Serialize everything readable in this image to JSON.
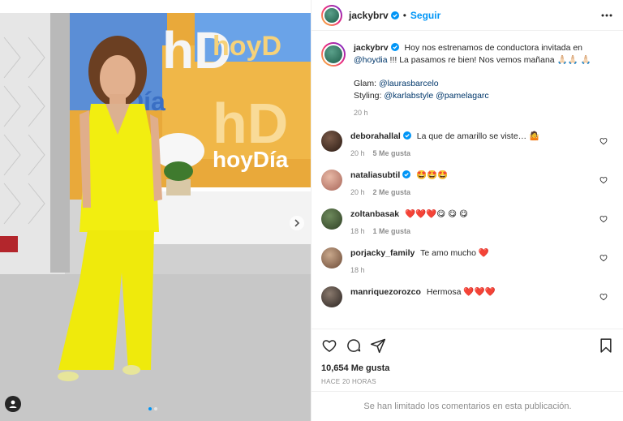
{
  "post": {
    "username": "jackybrv",
    "follow_label": "Seguir",
    "separator": "•",
    "more_icon": "more-horizontal-icon"
  },
  "media": {
    "image_text_top": "hoyD",
    "image_text_mid": "hoyDía",
    "image_text_badge": "hD"
  },
  "caption": {
    "username": "jackybrv",
    "text_part1": "Hoy nos estrenamos de conductora invitada en",
    "mention1": "@hoydia",
    "text_part2": "!!! La pasamos re bien! Nos vemos mañana 🙏🏻🙏🏻 🙏🏻",
    "glam_label": "Glam:",
    "glam_mention": "@laurasbarcelo",
    "styling_label": "Styling:",
    "styling_mention1": "@karlabstyle",
    "styling_mention2": "@pamelagarc",
    "time": "20 h"
  },
  "comments": [
    {
      "username": "deborahallal",
      "text": "La que de amarillo se viste… 🤷",
      "time": "20 h",
      "likes": "5 Me gusta",
      "verified": true
    },
    {
      "username": "nataliasubtil",
      "text": "🤩🤩🤩",
      "time": "20 h",
      "likes": "2 Me gusta",
      "verified": true
    },
    {
      "username": "zoltanbasak",
      "text": "❤️❤️❤️😋 😋 😋",
      "time": "18 h",
      "likes": "1 Me gusta",
      "verified": false
    },
    {
      "username": "porjacky_family",
      "text": "Te amo mucho ❤️",
      "time": "18 h",
      "likes": "",
      "verified": false
    },
    {
      "username": "manriquezorozco",
      "text": "Hermosa ❤️❤️❤️",
      "time": "",
      "likes": "",
      "verified": false
    }
  ],
  "actions": {
    "likes": "10,654 Me gusta",
    "ago": "HACE 20 HORAS",
    "limited": "Se han limitado los comentarios en esta publicación."
  },
  "colors": {
    "accent": "#0095f6",
    "suit": "#f2ee10",
    "heart": "#e0245e"
  }
}
